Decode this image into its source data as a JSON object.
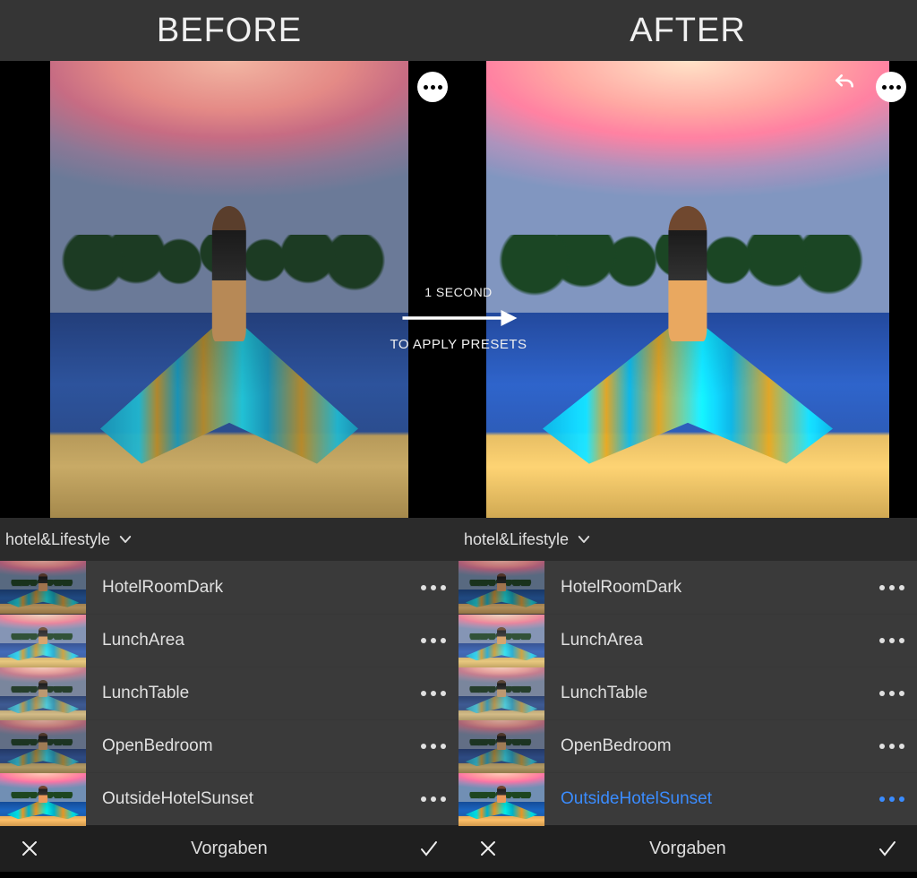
{
  "header": {
    "before": "BEFORE",
    "after": "AFTER"
  },
  "overlay": {
    "line1": "1 SECOND",
    "line2": "TO APPLY PRESETS"
  },
  "group_name": "hotel&Lifestyle",
  "presets": [
    {
      "name": "HotelRoomDark"
    },
    {
      "name": "LunchArea"
    },
    {
      "name": "LunchTable"
    },
    {
      "name": "OpenBedroom"
    },
    {
      "name": "OutsideHotelSunset"
    }
  ],
  "selected_preset_index_after": 4,
  "actionbar": {
    "title": "Vorgaben"
  },
  "icons": {
    "more": "more-horizontal-icon",
    "undo": "undo-icon",
    "chevron": "chevron-down-icon",
    "close": "close-icon",
    "check": "check-icon"
  }
}
